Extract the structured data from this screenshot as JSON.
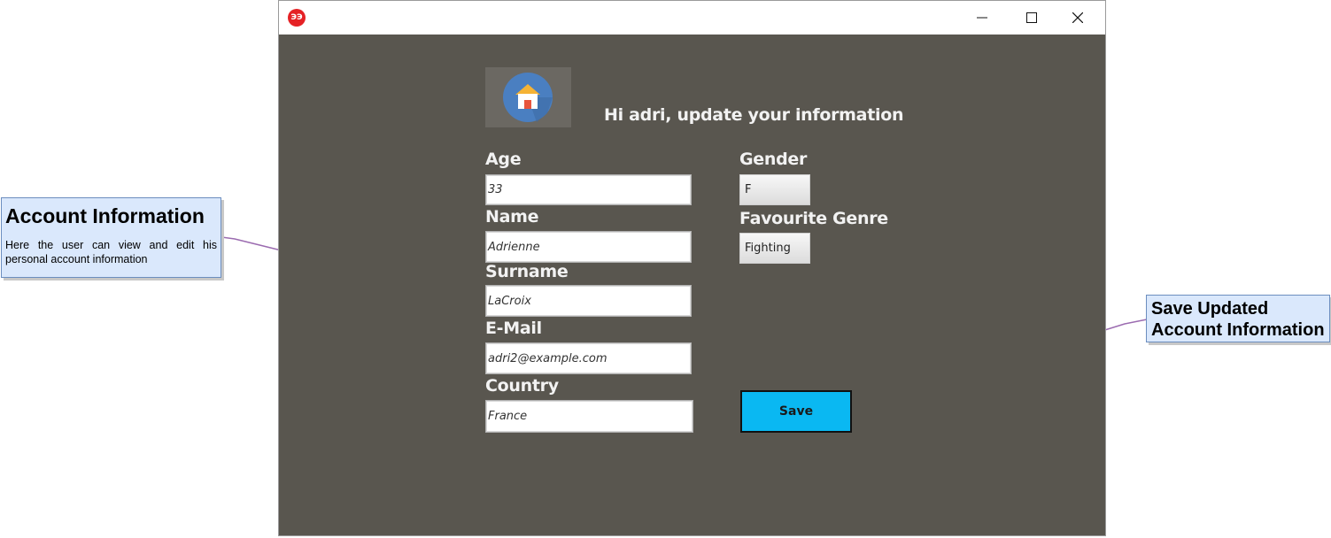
{
  "window": {
    "app_icon_text": "ЭЭ",
    "greeting": "Hi adri, update your information"
  },
  "form": {
    "age": {
      "label": "Age",
      "value": "33"
    },
    "name": {
      "label": "Name",
      "value": "Adrienne"
    },
    "surname": {
      "label": "Surname",
      "value": "LaCroix"
    },
    "email": {
      "label": "E-Mail",
      "value": "adri2@example.com"
    },
    "country": {
      "label": "Country",
      "value": "France"
    },
    "gender": {
      "label": "Gender",
      "value": "F"
    },
    "genre": {
      "label": "Favourite Genre",
      "value": "Fighting"
    },
    "save_label": "Save"
  },
  "annotations": {
    "account": {
      "title": "Account Information",
      "description": "Here the user can view and edit his personal account information"
    },
    "save": {
      "title": "Save Updated Account Information"
    }
  },
  "colors": {
    "background": "#59564f",
    "save_button": "#0ab8f2",
    "annotation_fill": "#dae8fc",
    "connector": "#9b6bb0"
  }
}
